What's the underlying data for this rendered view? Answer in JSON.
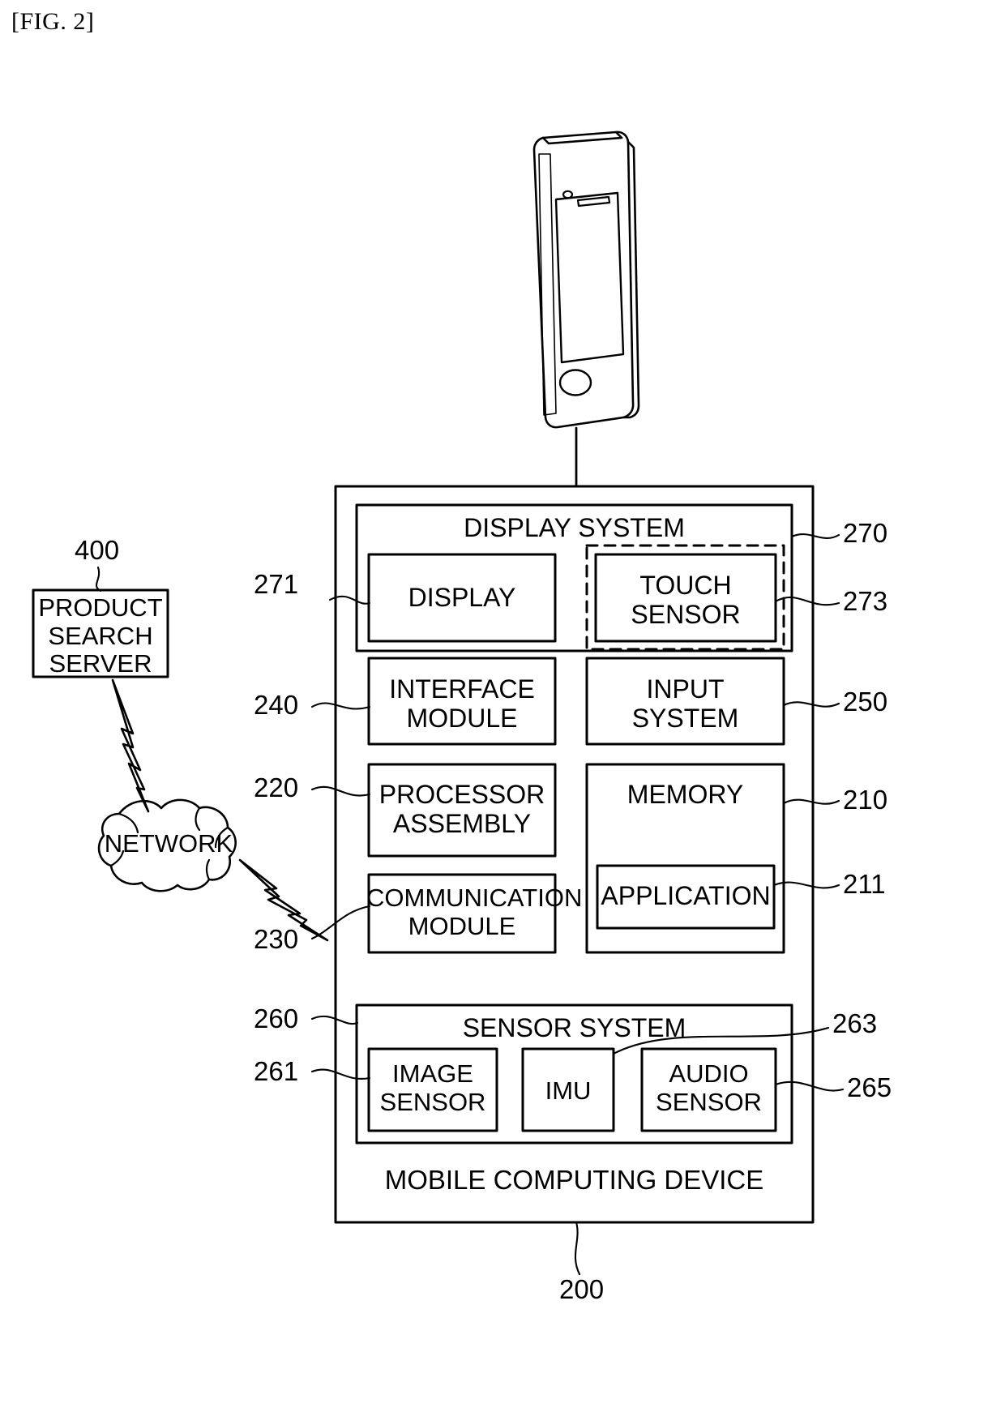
{
  "figure": {
    "title": "[FIG. 2]"
  },
  "server": {
    "label": "PRODUCT\nSEARCH\nSERVER",
    "ref": "400"
  },
  "network": {
    "label": "NETWORK"
  },
  "device": {
    "label": "MOBILE COMPUTING DEVICE",
    "ref": "200"
  },
  "display_system": {
    "label": "DISPLAY SYSTEM",
    "ref": "270",
    "display": {
      "label": "DISPLAY",
      "ref": "271"
    },
    "touch_sensor": {
      "label": "TOUCH\nSENSOR",
      "ref": "273"
    }
  },
  "interface_module": {
    "label": "INTERFACE\nMODULE",
    "ref": "240"
  },
  "input_system": {
    "label": "INPUT\nSYSTEM",
    "ref": "250"
  },
  "processor_assembly": {
    "label": "PROCESSOR\nASSEMBLY",
    "ref": "220"
  },
  "memory": {
    "label": "MEMORY",
    "ref": "210",
    "application": {
      "label": "APPLICATION",
      "ref": "211"
    }
  },
  "communication_module": {
    "label": "COMMUNICATION\nMODULE",
    "ref": "230"
  },
  "sensor_system": {
    "label": "SENSOR SYSTEM",
    "ref": "260",
    "image_sensor": {
      "label": "IMAGE\nSENSOR",
      "ref": "261"
    },
    "imu": {
      "label": "IMU",
      "ref": "263"
    },
    "audio_sensor": {
      "label": "AUDIO\nSENSOR",
      "ref": "265"
    }
  },
  "colors": {
    "line": "#000000",
    "background": "#ffffff"
  }
}
